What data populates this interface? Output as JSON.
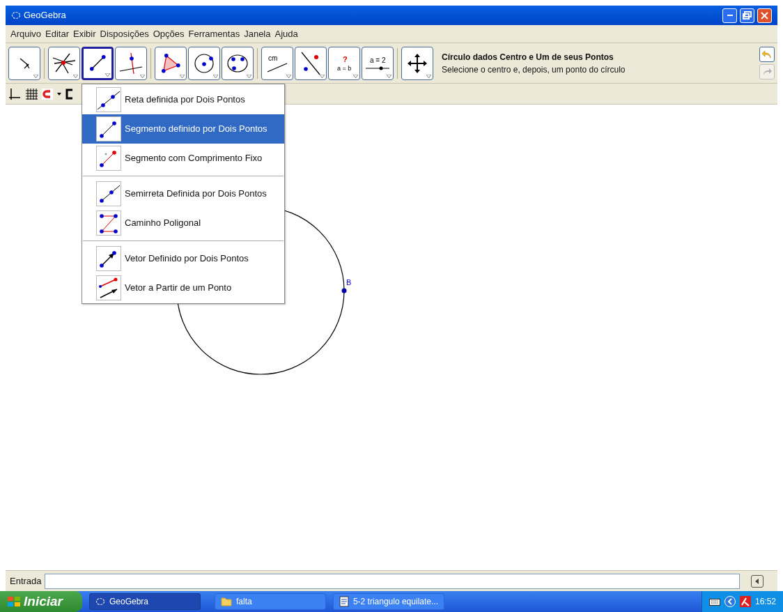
{
  "window": {
    "title": "GeoGebra"
  },
  "menu_bar": [
    "Arquivo",
    "Editar",
    "Exibir",
    "Disposições",
    "Opções",
    "Ferramentas",
    "Janela",
    "Ajuda"
  ],
  "tool_groups": [
    [
      {
        "kind": "move",
        "selected": false
      }
    ],
    [
      {
        "kind": "intersect",
        "selected": false
      },
      {
        "kind": "segment",
        "selected": true
      },
      {
        "kind": "perpendicular",
        "selected": false
      }
    ],
    [
      {
        "kind": "polygon",
        "selected": false
      },
      {
        "kind": "circle",
        "selected": false
      },
      {
        "kind": "conic",
        "selected": false
      }
    ],
    [
      {
        "kind": "distance",
        "selected": false,
        "icon_text": [
          "cm"
        ]
      },
      {
        "kind": "reflect",
        "selected": false
      },
      {
        "kind": "relation",
        "selected": false,
        "icon_text": [
          "?",
          "a = b"
        ]
      },
      {
        "kind": "slider",
        "selected": false,
        "icon_text": [
          "a = 2"
        ]
      }
    ],
    [
      {
        "kind": "pan",
        "selected": false
      }
    ]
  ],
  "tool_help": {
    "title": "Círculo dados Centro e Um de seus Pontos",
    "hint": "Selecione o centro e, depois, um ponto do círculo"
  },
  "dropdown": {
    "groups": [
      [
        {
          "label": "Reta definida por Dois Pontos",
          "kind": "line",
          "selected": false
        },
        {
          "label": "Segmento definido por Dois Pontos",
          "kind": "segment",
          "selected": true
        },
        {
          "label": "Segmento com Comprimento Fixo",
          "kind": "fixed",
          "selected": false
        }
      ],
      [
        {
          "label": "Semirreta Definida por Dois Pontos",
          "kind": "ray",
          "selected": false
        },
        {
          "label": "Caminho Poligonal",
          "kind": "polyline",
          "selected": false
        }
      ],
      [
        {
          "label": "Vetor Definido por Dois Pontos",
          "kind": "vector",
          "selected": false
        },
        {
          "label": "Vetor a Partir de um Ponto",
          "kind": "vectorfrom",
          "selected": false
        }
      ]
    ]
  },
  "canvas": {
    "point_label": "B"
  },
  "input_bar": {
    "label": "Entrada"
  },
  "taskbar": {
    "start": "Iniciar",
    "tasks": [
      {
        "label": "GeoGebra",
        "kind": "app",
        "selected": true
      },
      {
        "label": "falta",
        "kind": "folder",
        "selected": false
      },
      {
        "label": "5-2 triangulo equilate...",
        "kind": "doc",
        "selected": false
      }
    ],
    "clock": "16:52"
  }
}
